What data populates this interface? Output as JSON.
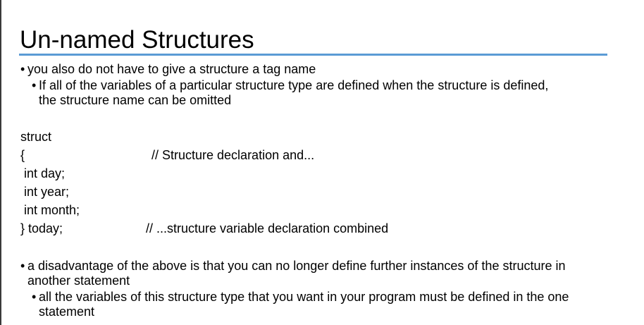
{
  "slide": {
    "title": "Un-named Structures",
    "accent_color": "#5b9bd5",
    "bullet_glyph": "•",
    "bullets_top": {
      "b1": "you also do not have to give a structure a tag name",
      "b2_line1": "If all of the variables of a particular structure type are defined when the structure is defined,",
      "b2_line2": "the structure name can be omitted"
    },
    "code": {
      "l1": "struct",
      "l2": "{",
      "l2_comment": "// Structure declaration and...",
      "l3": "int  day;",
      "l4": "int  year;",
      "l5": "int  month;",
      "l6": "} today;",
      "l6_comment": "// ...structure variable declaration combined"
    },
    "bullets_bottom": {
      "b3_line1": "a disadvantage of the above is that you can no longer define further instances of the structure in",
      "b3_line2": "another statement",
      "b4_line1": "all the variables of this structure type that you want in your program must be defined in the one",
      "b4_line2": "statement"
    }
  }
}
